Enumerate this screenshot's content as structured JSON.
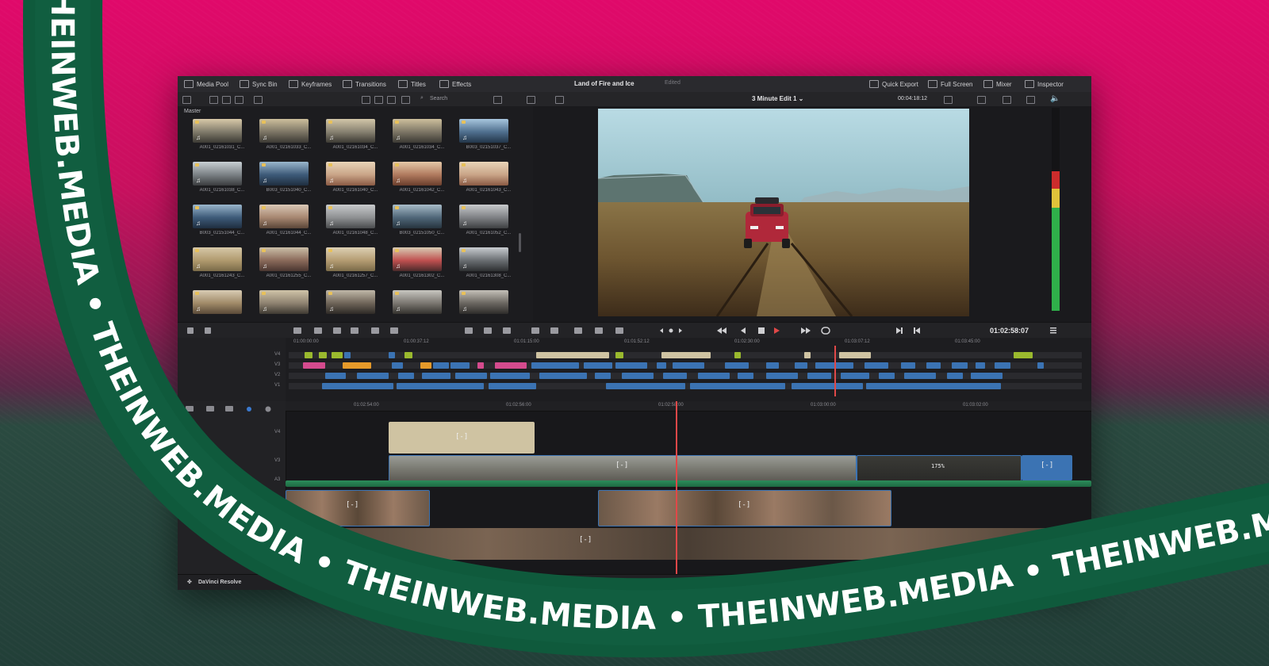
{
  "topbar": {
    "media_pool": "Media Pool",
    "sync_bin": "Sync Bin",
    "keyframes": "Keyframes",
    "transitions": "Transitions",
    "titles": "Titles",
    "effects": "Effects",
    "project_title": "Land of Fire and Ice",
    "status": "Edited",
    "quick_export": "Quick Export",
    "full_screen": "Full Screen",
    "mixer": "Mixer",
    "inspector": "Inspector"
  },
  "toolbar2": {
    "search_placeholder": "Search",
    "timeline_name": "3 Minute Edit 1",
    "duration": "00:04:18:12"
  },
  "media_pool": {
    "bin": "Master",
    "clips": [
      {
        "name": "A001_02161031_C..."
      },
      {
        "name": "A001_02161033_C..."
      },
      {
        "name": "A001_02161034_C..."
      },
      {
        "name": "A001_02161034_C..."
      },
      {
        "name": "B003_02151037_C..."
      },
      {
        "name": "A001_02161038_C..."
      },
      {
        "name": "B003_02151040_C..."
      },
      {
        "name": "A001_02161040_C..."
      },
      {
        "name": "A001_02161042_C..."
      },
      {
        "name": "A001_02161043_C..."
      },
      {
        "name": "B003_02151044_C..."
      },
      {
        "name": "A001_02161044_C..."
      },
      {
        "name": "A001_02161048_C..."
      },
      {
        "name": "B003_02151050_C..."
      },
      {
        "name": "A001_02161052_C..."
      },
      {
        "name": "A001_02161243_C..."
      },
      {
        "name": "A001_02161255_C..."
      },
      {
        "name": "A001_02161257_C..."
      },
      {
        "name": "A001_02161302_C..."
      },
      {
        "name": "A001_02161308_C..."
      },
      {
        "name": ""
      },
      {
        "name": ""
      },
      {
        "name": ""
      },
      {
        "name": ""
      },
      {
        "name": ""
      }
    ]
  },
  "transport": {
    "timecode": "01:02:58:07"
  },
  "mini_timeline": {
    "ruler": [
      "01:00:00:00",
      "01:00:37:12",
      "01:01:15:00",
      "01:01:52:12",
      "01:02:30:00",
      "01:03:07:12",
      "01:03:45:00"
    ],
    "tracks": [
      "V4",
      "V3",
      "V2",
      "V1"
    ],
    "playhead_ratio": 0.688
  },
  "main_timeline": {
    "ruler": [
      "01:02:54:00",
      "01:02:56:00",
      "01:02:58:00",
      "01:03:00:00",
      "01:03:02:00"
    ],
    "tracks": [
      "V4",
      "V3",
      "A3",
      "V2",
      "V1"
    ],
    "speed_badge": "175%",
    "fx_glyph": "[-]"
  },
  "footer": {
    "brand": "DaVinci Resolve"
  },
  "watermark": {
    "text": "THEINWEB.MEDIA",
    "separator": "•"
  },
  "colors": {
    "background_top": "#e0096a",
    "background_bottom": "#223f38",
    "ribbon": "#0f5a3c",
    "accent_playhead": "#e04848",
    "clip_blue": "#3b73b3",
    "clip_yellowgreen": "#9ab92e",
    "clip_orange": "#e59a2a",
    "clip_tan": "#cfc3a2",
    "clip_pink": "#d54b8e"
  }
}
